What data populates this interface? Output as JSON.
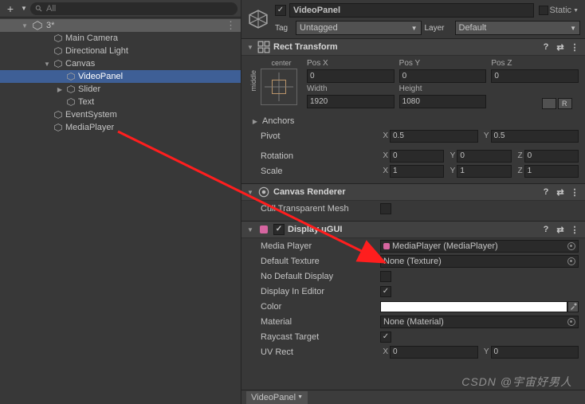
{
  "toolbar": {
    "search_placeholder": "All"
  },
  "hierarchy": {
    "scene": "3*",
    "nodes": [
      {
        "name": "Main Camera",
        "indent": 54,
        "fold": ""
      },
      {
        "name": "Directional Light",
        "indent": 54,
        "fold": ""
      },
      {
        "name": "Canvas",
        "indent": 54,
        "fold": "▼"
      },
      {
        "name": "VideoPanel",
        "indent": 70,
        "fold": "",
        "selected": true
      },
      {
        "name": "Slider",
        "indent": 70,
        "fold": "▶"
      },
      {
        "name": "Text",
        "indent": 70,
        "fold": ""
      },
      {
        "name": "EventSystem",
        "indent": 54,
        "fold": ""
      },
      {
        "name": "MediaPlayer",
        "indent": 54,
        "fold": ""
      }
    ]
  },
  "inspector": {
    "name": "VideoPanel",
    "static": "Static",
    "tag_label": "Tag",
    "tag_value": "Untagged",
    "layer_label": "Layer",
    "layer_value": "Default"
  },
  "rect": {
    "title": "Rect Transform",
    "center": "center",
    "middle": "middle",
    "posx_l": "Pos X",
    "posy_l": "Pos Y",
    "posz_l": "Pos Z",
    "posx": "0",
    "posy": "0",
    "posz": "0",
    "w_l": "Width",
    "h_l": "Height",
    "w": "1920",
    "h": "1080",
    "anchors": "Anchors",
    "pivot": "Pivot",
    "pivx": "0.5",
    "pivy": "0.5",
    "rotation": "Rotation",
    "rx": "0",
    "ry": "0",
    "rz": "0",
    "scale": "Scale",
    "sx": "1",
    "sy": "1",
    "sz": "1",
    "R": "R"
  },
  "canvasr": {
    "title": "Canvas Renderer",
    "cull": "Cull Transparent Mesh"
  },
  "display": {
    "title": "Display uGUI",
    "mediaPlayer_l": "Media Player",
    "mediaPlayer_v": "MediaPlayer (MediaPlayer)",
    "defTex_l": "Default Texture",
    "defTex_v": "None (Texture)",
    "noDef": "No Default Display",
    "inEditor": "Display In Editor",
    "color": "Color",
    "material_l": "Material",
    "material_v": "None (Material)",
    "raycast": "Raycast Target",
    "uvrect": "UV Rect",
    "uvx": "0",
    "uvy": "0"
  },
  "axes": {
    "x": "X",
    "y": "Y",
    "z": "Z"
  },
  "bottom": {
    "tab": "VideoPanel"
  },
  "watermark": "CSDN @宇宙好男人"
}
